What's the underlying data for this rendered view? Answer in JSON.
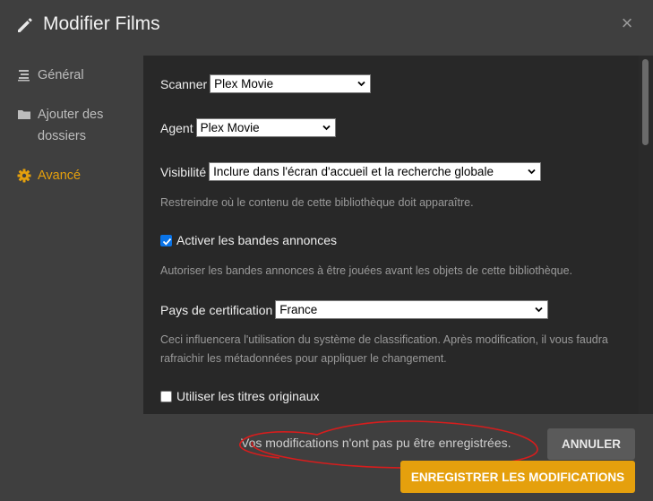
{
  "header": {
    "title": "Modifier Films",
    "close_glyph": "×"
  },
  "sidebar": {
    "items": [
      {
        "label": "Général",
        "icon": "lines-icon"
      },
      {
        "label": "Ajouter des dossiers",
        "icon": "folder-icon"
      },
      {
        "label": "Avancé",
        "icon": "gear-icon",
        "active": true
      }
    ]
  },
  "settings": {
    "scanner": {
      "label": "Scanner",
      "value": "Plex Movie"
    },
    "agent": {
      "label": "Agent",
      "value": "Plex Movie"
    },
    "visibility": {
      "label": "Visibilité",
      "value": "Inclure dans l'écran d'accueil et la recherche globale",
      "hint": "Restreindre où le contenu de cette bibliothèque doit apparaître."
    },
    "trailers": {
      "label": "Activer les bandes annonces",
      "checked": true,
      "hint": "Autoriser les bandes annonces à être jouées avant les objets de cette bibliothèque."
    },
    "certification": {
      "label": "Pays de certification",
      "value": "France",
      "hint": "Ceci influencera l'utilisation du système de classification. Après modification, il vous faudra rafraichir les métadonnées pour appliquer le changement."
    },
    "original_titles": {
      "label": "Utiliser les titres originaux",
      "checked": false
    }
  },
  "footer": {
    "message": "Vos modifications n'ont pas pu être enregistrées.",
    "cancel_label": "ANNULER",
    "save_label": "ENREGISTRER LES MODIFICATIONS"
  },
  "colors": {
    "accent": "#e5a00d",
    "panel": "#282828",
    "dialog": "#3f3f3f",
    "annotation": "#d61d1d"
  }
}
